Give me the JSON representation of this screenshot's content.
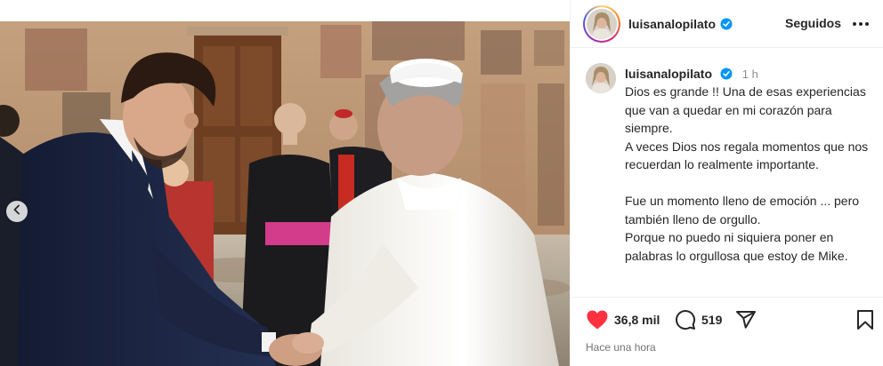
{
  "post": {
    "username": "luisanalopilato",
    "follow_status": "Seguidos",
    "time_ago": "1 h",
    "caption": "Dios es grande !! Una de esas experiencias que van a quedar en mi corazón para siempre.\nA veces Dios nos regala momentos que nos recuerdan lo realmente importante.\n\nFue un momento lleno de emoción ... pero también lleno de orgullo.\nPorque no puedo ni siquiera poner en palabras lo orgullosa que estoy de Mike.",
    "likes": "36,8 mil",
    "comments": "519",
    "timestamp": "Hace una hora"
  },
  "icons": {
    "verified": "verified-badge-icon",
    "more": "more-options-icon",
    "prev": "chevron-left-icon",
    "like": "heart-filled-icon",
    "comment": "comment-bubble-icon",
    "share": "paper-plane-icon",
    "save": "bookmark-icon"
  },
  "colors": {
    "verified_blue": "#0095f6",
    "like_red": "#ff3040",
    "text": "#262626",
    "muted": "#8e8e8e"
  }
}
